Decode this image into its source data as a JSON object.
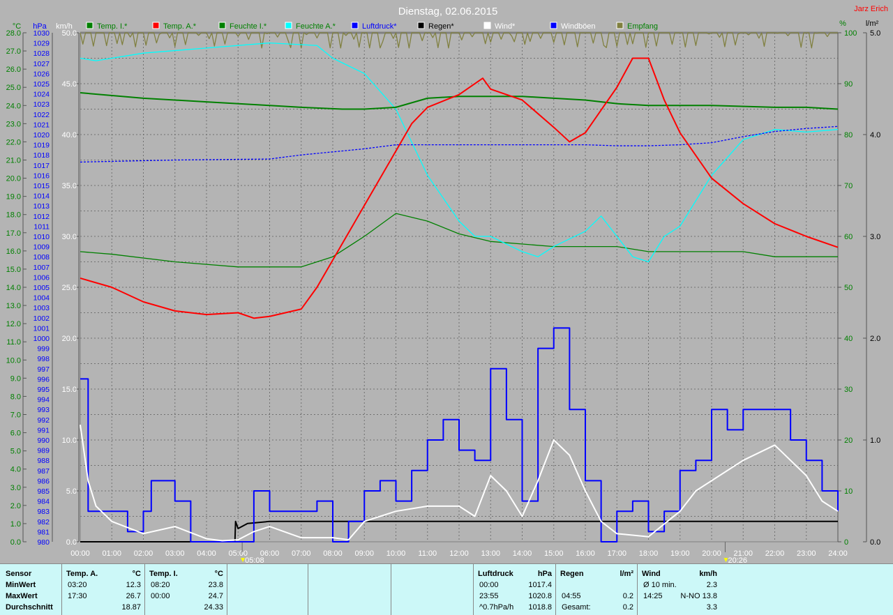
{
  "title": "Dienstag, 02.06.2015",
  "author": "Jarz Erich",
  "axis_units": {
    "temp": "°C",
    "pressure": "hPa",
    "wind": "km/h",
    "humidity": "%",
    "rain": "l/m²"
  },
  "legend": [
    {
      "label": "Temp. I.*",
      "color": "#008000",
      "text_color": "#008000"
    },
    {
      "label": "Temp. A.*",
      "color": "#ff0000",
      "text_color": "#008000"
    },
    {
      "label": "Feuchte I.*",
      "color": "#008000",
      "text_color": "#008000"
    },
    {
      "label": "Feuchte A.*",
      "color": "#00ffff",
      "text_color": "#008000"
    },
    {
      "label": "Luftdruck*",
      "color": "#0000ff",
      "text_color": "#0000ff"
    },
    {
      "label": "Regen*",
      "color": "#000000",
      "text_color": "#000000"
    },
    {
      "label": "Wind*",
      "color": "#ffffff",
      "text_color": "#ffffff"
    },
    {
      "label": "Windböen",
      "color": "#0000ff",
      "text_color": "#ffffff"
    },
    {
      "label": "Empfang",
      "color": "#808040",
      "text_color": "#008000"
    }
  ],
  "markers": [
    {
      "label": "05:08",
      "time": 5.13
    },
    {
      "label": "20:26",
      "time": 20.43
    }
  ],
  "chart_data": {
    "type": "line",
    "title": "Dienstag, 02.06.2015",
    "x_ticks": [
      "00:00",
      "01:00",
      "02:00",
      "03:00",
      "04:00",
      "05:00",
      "06:00",
      "07:00",
      "08:00",
      "09:00",
      "10:00",
      "11:00",
      "12:00",
      "13:00",
      "14:00",
      "15:00",
      "16:00",
      "17:00",
      "18:00",
      "19:00",
      "20:00",
      "21:00",
      "22:00",
      "23:00",
      "24:00"
    ],
    "x_range_hours": [
      0,
      24
    ],
    "temp_ticks": [
      "28.0",
      "27.0",
      "26.0",
      "25.0",
      "24.0",
      "23.0",
      "22.0",
      "21.0",
      "20.0",
      "19.0",
      "18.0",
      "17.0",
      "16.0",
      "15.0",
      "14.0",
      "13.0",
      "12.0",
      "11.0",
      "10.0",
      "9.0",
      "8.0",
      "7.0",
      "6.0",
      "5.0",
      "4.0",
      "3.0",
      "2.0",
      "1.0",
      "0.0"
    ],
    "temp_range": [
      0,
      28
    ],
    "pressure_range": [
      980,
      1030
    ],
    "wind_ticks": [
      "50.0",
      "45.0",
      "40.0",
      "35.0",
      "30.0",
      "25.0",
      "20.0",
      "15.0",
      "10.0",
      "5.0",
      "0.0"
    ],
    "wind_range": [
      0,
      50
    ],
    "humidity_ticks": [
      "100",
      "90",
      "80",
      "70",
      "60",
      "50",
      "40",
      "30",
      "20",
      "10",
      "0"
    ],
    "humidity_range": [
      0,
      100
    ],
    "rain_ticks": [
      "5.0",
      "4.0",
      "3.0",
      "2.0",
      "1.0",
      "0.0"
    ],
    "rain_range": [
      0,
      5
    ],
    "series": [
      {
        "name": "Temp. A.",
        "axis": "temp",
        "color": "#ff0000",
        "x": [
          0,
          1,
          2,
          3,
          4,
          5,
          5.5,
          6,
          7,
          7.5,
          8,
          9,
          10,
          10.5,
          11,
          12,
          12.75,
          13,
          14,
          15,
          15.5,
          16,
          17,
          17.5,
          18,
          18.5,
          19,
          20,
          21,
          22,
          23,
          24
        ],
        "y": [
          14.5,
          14.0,
          13.2,
          12.7,
          12.5,
          12.6,
          12.3,
          12.4,
          12.8,
          14.0,
          15.5,
          18.5,
          21.5,
          23.0,
          23.9,
          24.6,
          25.5,
          24.9,
          24.3,
          22.8,
          22.0,
          22.5,
          25.0,
          26.6,
          26.6,
          24.3,
          22.5,
          20.0,
          18.6,
          17.5,
          16.8,
          16.2
        ]
      },
      {
        "name": "Temp. I.",
        "axis": "temp",
        "color": "#008000",
        "x": [
          0,
          2,
          4,
          6,
          7,
          8.3,
          9,
          10,
          11,
          12,
          13,
          14,
          15,
          16,
          17,
          18,
          20,
          22,
          23,
          24
        ],
        "y": [
          24.7,
          24.4,
          24.2,
          24.0,
          23.9,
          23.8,
          23.8,
          23.9,
          24.4,
          24.5,
          24.5,
          24.5,
          24.4,
          24.3,
          24.1,
          24.0,
          24.0,
          23.9,
          23.9,
          23.8
        ]
      },
      {
        "name": "Feuchte I.",
        "axis": "humidity",
        "color": "#008000",
        "x": [
          0,
          1,
          3,
          5,
          7,
          8,
          9,
          10,
          11,
          12,
          13,
          15,
          17,
          18,
          21,
          22,
          24
        ],
        "y": [
          57,
          56.5,
          55,
          54,
          54,
          56,
          60,
          64.5,
          63,
          60.5,
          59,
          58,
          58,
          57,
          57,
          56,
          56
        ]
      },
      {
        "name": "Feuchte A.",
        "axis": "humidity",
        "color": "#00ffff",
        "x": [
          0,
          0.5,
          2,
          4,
          6,
          7.5,
          8,
          9,
          10,
          11,
          12,
          12.5,
          13,
          14,
          14.5,
          15,
          16,
          16.5,
          17,
          17.5,
          18,
          18.5,
          19,
          20,
          21,
          22,
          23,
          24
        ],
        "y": [
          95,
          94.5,
          96,
          97,
          98,
          97.5,
          95,
          92,
          85,
          72,
          63,
          60,
          60,
          57,
          56,
          58,
          61,
          64,
          60,
          56,
          55,
          60,
          62,
          72,
          79,
          81,
          80.5,
          81
        ]
      },
      {
        "name": "Luftdruck",
        "axis": "pressure",
        "color": "#0000ff",
        "dashed": true,
        "x": [
          0,
          3,
          6,
          7,
          8,
          9,
          10,
          12,
          14,
          16,
          17,
          18,
          19,
          20,
          21,
          22,
          23,
          24
        ],
        "y": [
          1017.3,
          1017.5,
          1017.6,
          1018.0,
          1018.3,
          1018.6,
          1019.0,
          1019.0,
          1019.0,
          1019.0,
          1018.9,
          1018.9,
          1019.0,
          1019.2,
          1019.8,
          1020.3,
          1020.6,
          1020.8
        ]
      },
      {
        "name": "Windböen",
        "axis": "wind",
        "color": "#0000ff",
        "step": true,
        "x": [
          0,
          0.25,
          1,
          1.5,
          2,
          2.25,
          3,
          3.5,
          4,
          5,
          5.5,
          6,
          6.5,
          7,
          7.5,
          8,
          8.5,
          9,
          9.5,
          10,
          10.5,
          11,
          11.5,
          12,
          12.5,
          13,
          13.5,
          14,
          14.5,
          15,
          15.5,
          16,
          16.5,
          17,
          17.5,
          18,
          18.5,
          19,
          19.5,
          20,
          20.5,
          21,
          21.5,
          22,
          22.5,
          23,
          23.5,
          24
        ],
        "y": [
          16,
          3,
          3,
          1,
          3,
          6,
          4,
          0,
          0,
          0,
          5,
          3,
          3,
          3,
          4,
          0,
          2,
          5,
          6,
          4,
          7,
          10,
          12,
          9,
          8,
          17,
          12,
          4,
          19,
          21,
          13,
          6,
          0,
          3,
          4,
          1,
          3,
          7,
          8,
          13,
          11,
          13,
          13,
          13,
          10,
          8,
          5,
          3
        ]
      },
      {
        "name": "Wind",
        "axis": "wind",
        "color": "#ffffff",
        "x": [
          0,
          0.25,
          0.5,
          1,
          2,
          3,
          4,
          4.5,
          5,
          5.5,
          6,
          7,
          8,
          8.5,
          9,
          10,
          11,
          12,
          12.5,
          13,
          13.5,
          14,
          14.5,
          15,
          15.5,
          16,
          16.5,
          17,
          18,
          19,
          19.5,
          20,
          21,
          22,
          23,
          23.5,
          24
        ],
        "y": [
          11.5,
          6,
          3.5,
          2,
          0.8,
          1.5,
          0.3,
          0.1,
          0.2,
          1,
          1.5,
          0.4,
          0.4,
          0.2,
          2,
          3,
          3.5,
          3.5,
          2.5,
          6.5,
          5,
          2.5,
          6,
          10,
          8.5,
          5,
          2,
          0.8,
          0.5,
          3,
          5,
          6,
          8,
          9.5,
          6.5,
          4,
          3
        ]
      },
      {
        "name": "Regen",
        "axis": "rain",
        "color": "#000000",
        "x": [
          0,
          4.9,
          4.92,
          5.0,
          5.3,
          6,
          24
        ],
        "y": [
          0,
          0,
          0.2,
          0.13,
          0.18,
          0.2,
          0.2
        ]
      },
      {
        "name": "Empfang",
        "axis": "humidity",
        "color": "#808040",
        "noisy": true,
        "x": [
          0,
          24
        ],
        "y": [
          100,
          100
        ]
      }
    ]
  },
  "table": {
    "sensor_col": {
      "header": "Sensor",
      "rows": [
        "MinWert",
        "MaxWert",
        "Durchschnitt"
      ]
    },
    "temp_a": {
      "header": "Temp. A.",
      "unit": "°C",
      "rows": [
        [
          "03:20",
          "12.3"
        ],
        [
          "17:30",
          "26.7"
        ],
        [
          "",
          "18.87"
        ]
      ]
    },
    "temp_i": {
      "header": "Temp. I.",
      "unit": "°C",
      "rows": [
        [
          "08:20",
          "23.8"
        ],
        [
          "00:00",
          "24.7"
        ],
        [
          "",
          "24.33"
        ]
      ]
    },
    "pressure": {
      "header": "Luftdruck",
      "unit": "hPa",
      "rows": [
        [
          "00:00",
          "1017.4"
        ],
        [
          "23:55",
          "1020.8"
        ],
        [
          "^0.7hPa/h",
          "1018.8"
        ]
      ]
    },
    "rain": {
      "header": "Regen",
      "unit": "l/m²",
      "rows": [
        [
          "",
          ""
        ],
        [
          "04:55",
          "0.2"
        ],
        [
          "Gesamt:",
          "0.2"
        ]
      ]
    },
    "wind": {
      "header": "Wind",
      "unit": "km/h",
      "rows": [
        [
          "Ø 10 min.",
          "2.3"
        ],
        [
          "14:25",
          "N-NO 13.8"
        ],
        [
          "",
          "3.3"
        ]
      ]
    }
  }
}
